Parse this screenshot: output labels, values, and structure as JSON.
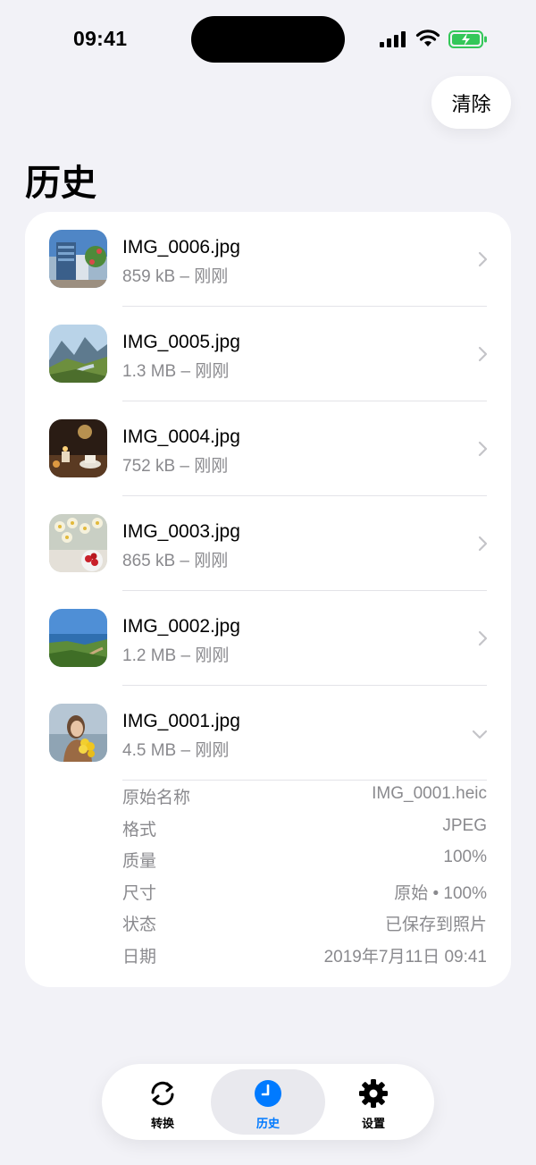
{
  "status": {
    "time": "09:41"
  },
  "header": {
    "clear_label": "清除",
    "title": "历史"
  },
  "history": [
    {
      "name": "IMG_0006.jpg",
      "meta": "859 kB – 刚刚",
      "thumb": "city-building"
    },
    {
      "name": "IMG_0005.jpg",
      "meta": "1.3 MB – 刚刚",
      "thumb": "mountain-valley"
    },
    {
      "name": "IMG_0004.jpg",
      "meta": "752 kB – 刚刚",
      "thumb": "candle-cafe"
    },
    {
      "name": "IMG_0003.jpg",
      "meta": "865 kB – 刚刚",
      "thumb": "flowers-berries"
    },
    {
      "name": "IMG_0002.jpg",
      "meta": "1.2 MB – 刚刚",
      "thumb": "coast-path"
    },
    {
      "name": "IMG_0001.jpg",
      "meta": "4.5 MB – 刚刚",
      "thumb": "woman-flowers"
    }
  ],
  "details": [
    {
      "label": "原始名称",
      "value": "IMG_0001.heic"
    },
    {
      "label": "格式",
      "value": "JPEG"
    },
    {
      "label": "质量",
      "value": "100%"
    },
    {
      "label": "尺寸",
      "value": "原始 • 100%"
    },
    {
      "label": "状态",
      "value": "已保存到照片"
    },
    {
      "label": "日期",
      "value": "2019年7月11日 09:41"
    }
  ],
  "tabs": [
    {
      "label": "转换",
      "icon": "convert-icon"
    },
    {
      "label": "历史",
      "icon": "clock-icon"
    },
    {
      "label": "设置",
      "icon": "gear-icon"
    }
  ],
  "colors": {
    "accent": "#007aff",
    "background": "#f2f2f7",
    "battery": "#34c759"
  }
}
